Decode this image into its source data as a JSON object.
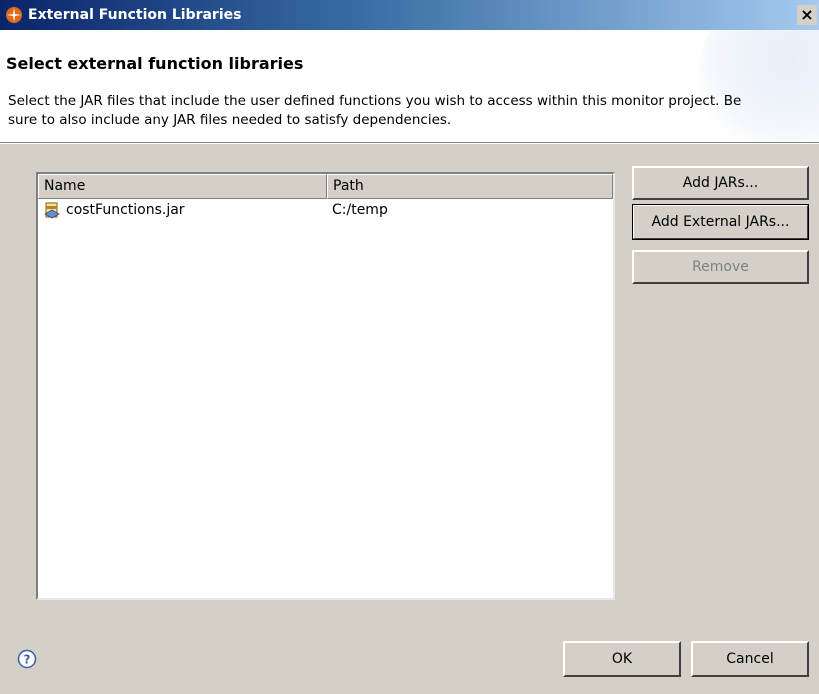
{
  "window": {
    "title": "External Function Libraries",
    "close_glyph": "×"
  },
  "banner": {
    "title": "Select external function libraries",
    "description": "Select the JAR files that include the user defined functions you wish to access within this monitor project. Be sure to also include any JAR files needed to satisfy dependencies."
  },
  "table": {
    "columns": [
      "Name",
      "Path"
    ],
    "rows": [
      {
        "name": "costFunctions.jar",
        "path": "C:/temp",
        "icon": "jar-icon"
      }
    ]
  },
  "buttons": {
    "add_jars": "Add JARs...",
    "add_external_jars": "Add External JARs...",
    "remove": "Remove",
    "ok": "OK",
    "cancel": "Cancel"
  },
  "icons": {
    "app": "eclipse-wand-icon",
    "help": "help-icon"
  },
  "colors": {
    "titlebar_start": "#0a246a",
    "titlebar_end": "#a6caf0",
    "dialog_bg": "#d4d0c8",
    "disabled_text": "#808080"
  }
}
